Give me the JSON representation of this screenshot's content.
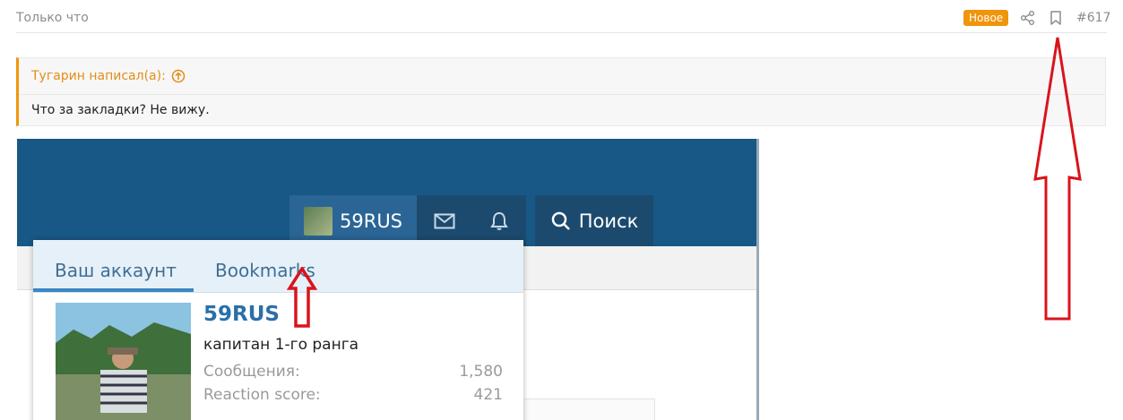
{
  "post": {
    "timestamp": "Только что",
    "badge": "Новое",
    "number": "#617"
  },
  "quote": {
    "author": "Тугарин написал(а):",
    "text": "Что за закладки? Не вижу."
  },
  "embed": {
    "nav": {
      "username": "59RUS",
      "search_label": "Поиск"
    },
    "dropdown": {
      "tabs": [
        "Ваш аккаунт",
        "Bookmarks"
      ],
      "profile": {
        "name": "59RUS",
        "rank": "капитан 1-го ранга",
        "stats": [
          {
            "label": "Сообщения:",
            "value": "1,580"
          },
          {
            "label": "Reaction score:",
            "value": "421"
          }
        ]
      }
    }
  },
  "icons": [
    "share-icon",
    "bookmark-icon",
    "arrow-up-circle-icon",
    "envelope-icon",
    "bell-icon",
    "search-icon"
  ],
  "colors": {
    "accent": "#f0950b",
    "nav_bg": "#185886",
    "link": "#2b6faa",
    "annotation": "#d9141c"
  }
}
